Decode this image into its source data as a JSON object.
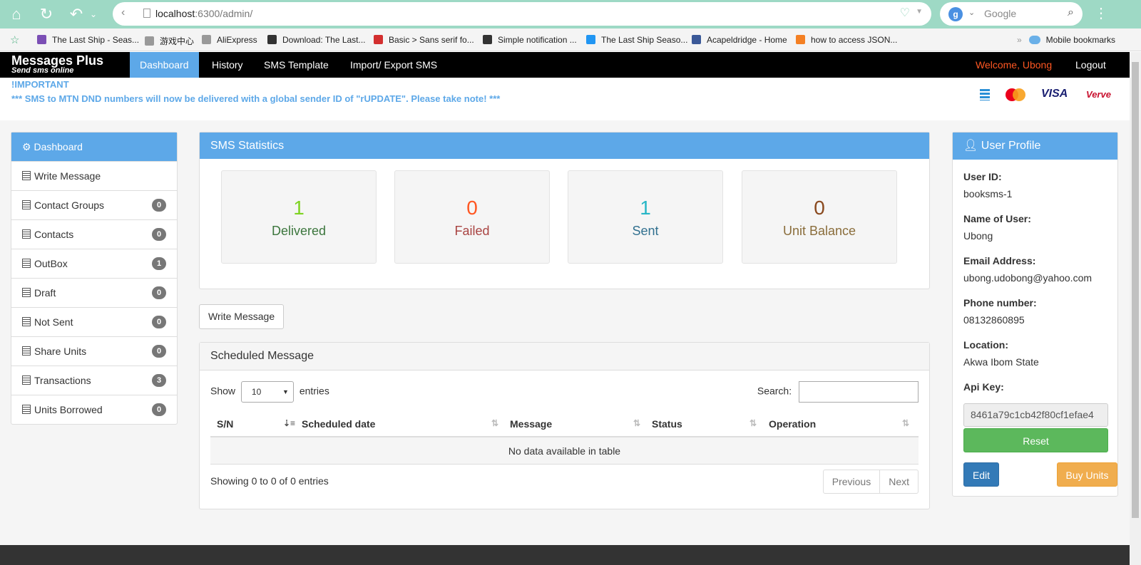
{
  "browser": {
    "url_host": "localhost",
    "url_path": ":6300/admin/",
    "search_placeholder": "Google",
    "bookmarks": [
      {
        "label": "The Last Ship - Seas...",
        "color": "#7b4fb5"
      },
      {
        "label": "游戏中心",
        "color": "#999999"
      },
      {
        "label": "AliExpress",
        "color": "#999999"
      },
      {
        "label": "Download: The Last...",
        "color": "#333333"
      },
      {
        "label": "Basic > Sans serif fo...",
        "color": "#d32f2f"
      },
      {
        "label": "Simple notification ...",
        "color": "#333333"
      },
      {
        "label": "The Last Ship Seaso...",
        "color": "#2196f3"
      },
      {
        "label": "Acapeldridge - Home",
        "color": "#3b5998"
      },
      {
        "label": "how to access JSON...",
        "color": "#f48024"
      }
    ],
    "bookmarks_more": "Mobile bookmarks"
  },
  "navbar": {
    "brand_title": "Messages Plus",
    "brand_sub": "Send sms online",
    "links": [
      "Dashboard",
      "History",
      "SMS Template",
      "Import/ Export SMS"
    ],
    "welcome": "Welcome, Ubong",
    "logout": "Logout"
  },
  "notice": {
    "important": "!IMPORTANT",
    "message": "*** SMS to MTN DND numbers will now be delivered with a global sender ID of \"rUPDATE\". Please take note! ***",
    "cards": [
      "VISA",
      "Verve"
    ]
  },
  "sidebar": {
    "header": "Dashboard",
    "items": [
      {
        "label": "Write Message",
        "badge": ""
      },
      {
        "label": "Contact Groups",
        "badge": "0"
      },
      {
        "label": "Contacts",
        "badge": "0"
      },
      {
        "label": "OutBox",
        "badge": "1"
      },
      {
        "label": "Draft",
        "badge": "0"
      },
      {
        "label": "Not Sent",
        "badge": "0"
      },
      {
        "label": "Share Units",
        "badge": "0"
      },
      {
        "label": "Transactions",
        "badge": "3"
      },
      {
        "label": "Units Borrowed",
        "badge": "0"
      }
    ]
  },
  "stats": {
    "title": "SMS Statistics",
    "items": [
      {
        "value": "1",
        "label": "Delivered",
        "num_color": "#7ed321",
        "label_color": "#3c763d"
      },
      {
        "value": "0",
        "label": "Failed",
        "num_color": "#ff5722",
        "label_color": "#a94442"
      },
      {
        "value": "1",
        "label": "Sent",
        "num_color": "#26b6c6",
        "label_color": "#31708f"
      },
      {
        "value": "0",
        "label": "Unit Balance",
        "num_color": "#8a4a1f",
        "label_color": "#8a6d3b"
      }
    ]
  },
  "write_message_button": "Write Message",
  "scheduled": {
    "title": "Scheduled Message",
    "show_label": "Show",
    "entries_value": "10",
    "entries_label": "entries",
    "search_label": "Search:",
    "columns": [
      "S/N",
      "Scheduled date",
      "Message",
      "Status",
      "Operation"
    ],
    "empty": "No data available in table",
    "info": "Showing 0 to 0 of 0 entries",
    "prev": "Previous",
    "next": "Next"
  },
  "profile": {
    "title": "User Profile",
    "fields": [
      {
        "label": "User ID:",
        "value": "booksms-1"
      },
      {
        "label": "Name of User:",
        "value": "Ubong"
      },
      {
        "label": "Email Address:",
        "value": "ubong.udobong@yahoo.com"
      },
      {
        "label": "Phone number:",
        "value": "08132860895"
      },
      {
        "label": "Location:",
        "value": "Akwa Ibom State"
      },
      {
        "label": "Api Key:",
        "value": ""
      }
    ],
    "api_key": "8461a79c1cb42f80cf1efae4",
    "reset": "Reset",
    "edit": "Edit",
    "buy": "Buy Units"
  }
}
